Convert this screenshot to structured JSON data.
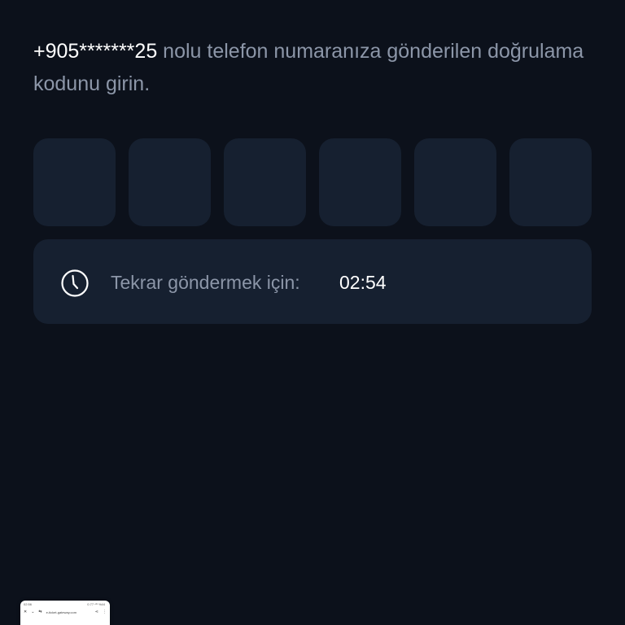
{
  "instruction": {
    "phone": "+905*******25",
    "text": " nolu telefon numaranıza gönderilen doğrulama kodunu girin."
  },
  "otp": {
    "digits": [
      "",
      "",
      "",
      "",
      "",
      ""
    ]
  },
  "resend": {
    "icon": "clock-icon",
    "label": "Tekrar göndermek için:",
    "timer": "02:54"
  },
  "thumbnail": {
    "status_left": "02:56",
    "status_right": "0.77 ⁴ᴳ %44",
    "url": "e-ticket-gateway.com"
  },
  "colors": {
    "background": "#0c111b",
    "card": "#162030",
    "muted_text": "#8c96a8",
    "primary_text": "#ffffff"
  }
}
